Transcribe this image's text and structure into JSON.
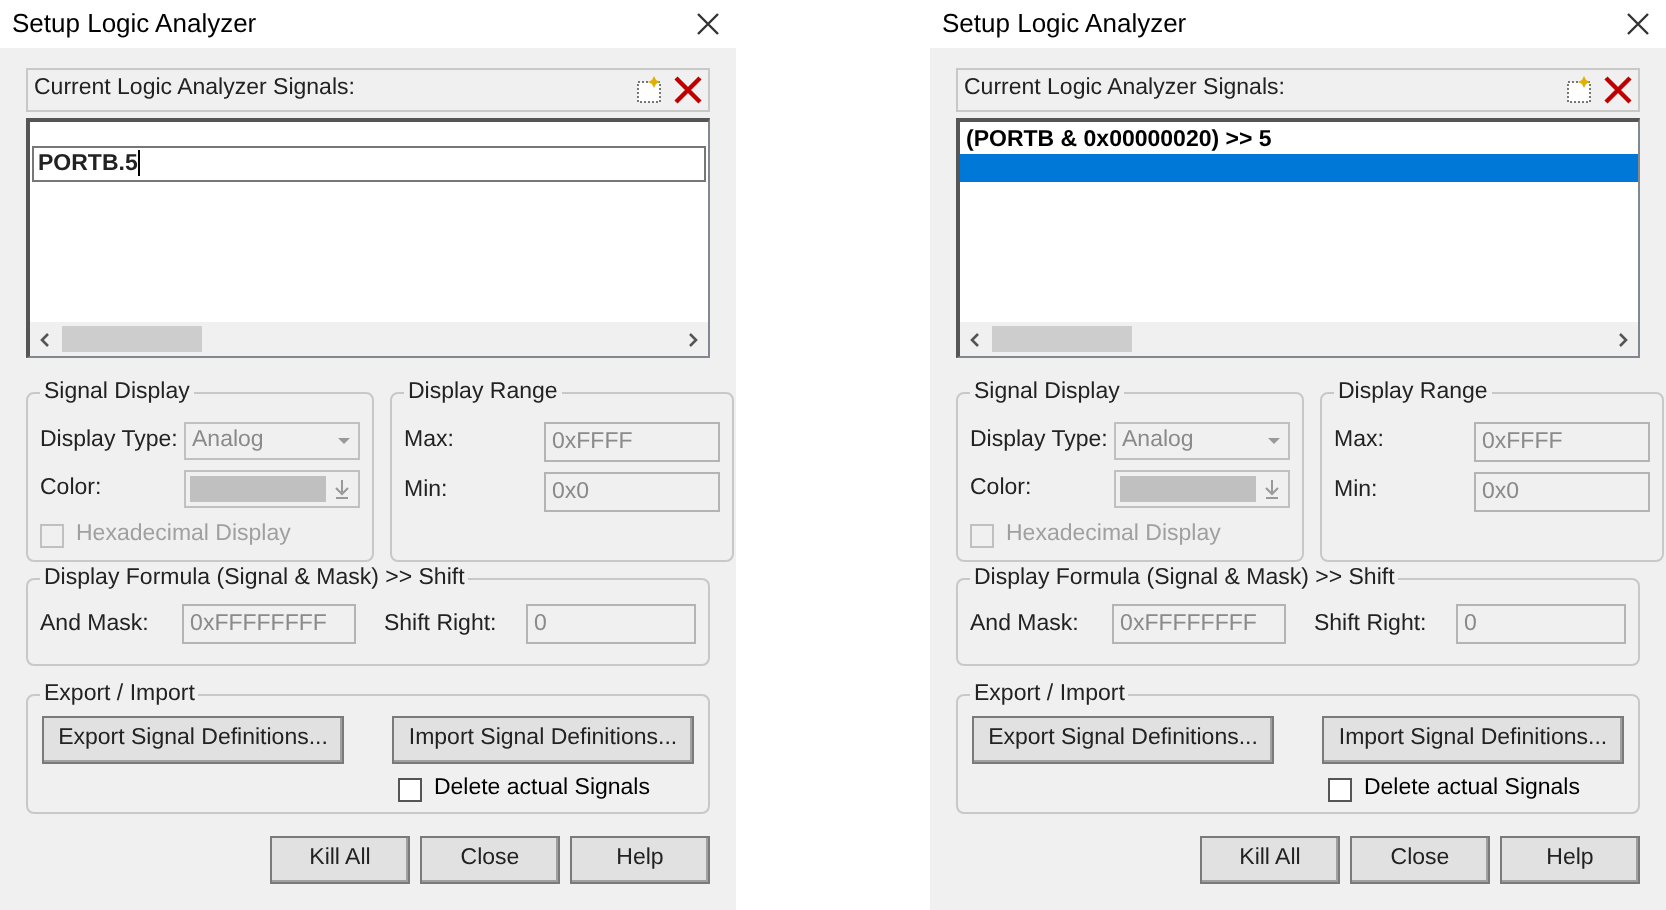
{
  "dialogs": [
    {
      "title": "Setup Logic Analyzer",
      "signals_label": "Current Logic Analyzer Signals:",
      "signals": [
        {
          "kind": "editing",
          "text": "PORTB.5"
        }
      ],
      "signal_display": {
        "title": "Signal Display",
        "display_type_label": "Display Type:",
        "display_type": "Analog",
        "color_label": "Color:",
        "hex_label": "Hexadecimal Display",
        "hex_checked": false
      },
      "display_range": {
        "title": "Display Range",
        "max_label": "Max:",
        "max": "0xFFFF",
        "min_label": "Min:",
        "min": "0x0"
      },
      "formula": {
        "title": "Display Formula (Signal & Mask) >> Shift",
        "mask_label": "And Mask:",
        "mask": "0xFFFFFFFF",
        "shift_label": "Shift Right:",
        "shift": "0"
      },
      "export_import": {
        "title": "Export / Import",
        "export": "Export Signal Definitions...",
        "import": "Import Signal Definitions...",
        "delete_label": "Delete actual Signals",
        "delete_checked": false
      },
      "buttons": [
        "Kill All",
        "Close",
        "Help"
      ]
    },
    {
      "title": "Setup Logic Analyzer",
      "signals_label": "Current Logic Analyzer Signals:",
      "signals": [
        {
          "kind": "text",
          "text": "(PORTB & 0x00000020) >> 5",
          "selected": false
        },
        {
          "kind": "text",
          "selected": true
        }
      ],
      "signal_display": {
        "title": "Signal Display",
        "display_type_label": "Display Type:",
        "display_type": "Analog",
        "color_label": "Color:",
        "hex_label": "Hexadecimal Display",
        "hex_checked": false
      },
      "display_range": {
        "title": "Display Range",
        "max_label": "Max:",
        "max": "0xFFFF",
        "min_label": "Min:",
        "min": "0x0"
      },
      "formula": {
        "title": "Display Formula (Signal & Mask) >> Shift",
        "mask_label": "And Mask:",
        "mask": "0xFFFFFFFF",
        "shift_label": "Shift Right:",
        "shift": "0"
      },
      "export_import": {
        "title": "Export / Import",
        "export": "Export Signal Definitions...",
        "import": "Import Signal Definitions...",
        "delete_label": "Delete actual Signals",
        "delete_checked": false
      },
      "buttons": [
        "Kill All",
        "Close",
        "Help"
      ]
    }
  ]
}
